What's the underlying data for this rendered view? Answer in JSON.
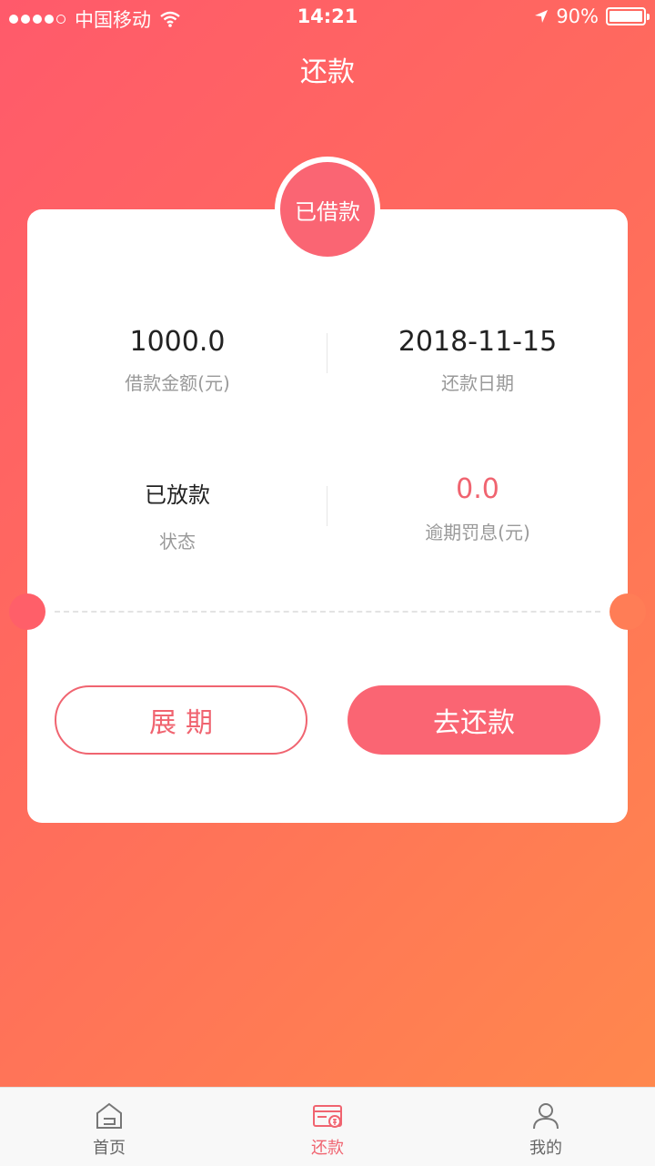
{
  "status_bar": {
    "carrier": "中国移动",
    "time": "14:21",
    "battery": "90%"
  },
  "nav": {
    "title": "还款"
  },
  "loan": {
    "status_badge": "已借款",
    "amount": "1000.0",
    "amount_label": "借款金额(元)",
    "repay_date": "2018-11-15",
    "repay_date_label": "还款日期",
    "status": "已放款",
    "status_label": "状态",
    "penalty": "0.0",
    "penalty_label": "逾期罚息(元)"
  },
  "actions": {
    "extend_label": "展期",
    "repay_label": "去还款"
  },
  "tabs": [
    {
      "label": "首页",
      "icon": "home-icon",
      "active": false
    },
    {
      "label": "还款",
      "icon": "repay-card-icon",
      "active": true
    },
    {
      "label": "我的",
      "icon": "user-icon",
      "active": false
    }
  ],
  "colors": {
    "accent": "#fa6573",
    "gradient_start": "#ff5a6b",
    "gradient_end": "#ff8a4c"
  }
}
